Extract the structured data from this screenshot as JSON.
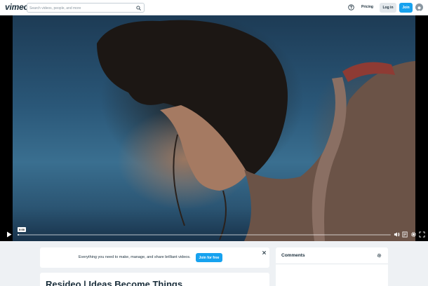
{
  "header": {
    "logo": "vimeo",
    "search_placeholder": "Search videos, people, and more",
    "pricing_label": "Pricing",
    "login_label": "Log in",
    "join_label": "Join"
  },
  "player": {
    "current_time": "0:00",
    "progress_fraction": 0.003
  },
  "promo": {
    "text": "Everything you need to make, manage, and share brilliant videos.",
    "button_label": "Join for free"
  },
  "video": {
    "title": "Resideo | Ideas Become Things"
  },
  "comments": {
    "heading": "Comments"
  },
  "colors": {
    "accent": "#17a2ef",
    "text": "#1a2e3b",
    "page_bg": "#eef1f4"
  }
}
